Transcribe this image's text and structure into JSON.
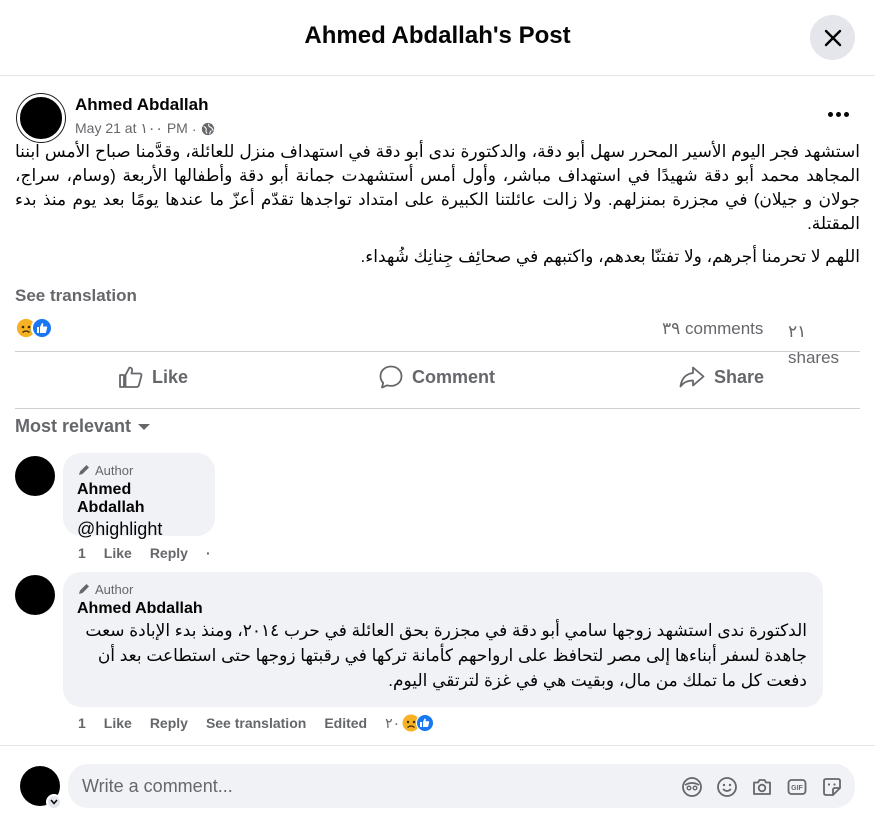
{
  "dialog": {
    "title": "Ahmed Abdallah's Post"
  },
  "post": {
    "author": "Ahmed Abdallah",
    "date": "May 21 at ١٠٠ PM",
    "separator": "·",
    "privacy_icon": "globe-icon",
    "paragraphs": [
      "استشهد فجر اليوم الأسير المحرر سهل أبو دقة، والدكتورة ندى أبو دقة في استهداف منزل للعائلة، وقدَّمنا صباح الأمس ابننا المجاهد محمد أبو دقة شهيدًا في استهداف مباشر، وأول أمس أستشهدت جمانة أبو دقة وأطفالها الأربعة (وسام، سراج، جولان و جيلان) في مجزرة بمنزلهم. ولا زالت عائلتنا الكبيرة على امتداد تواجدها تقدّم أعزّ ما عندها يومًا بعد يوم منذ بدء المقتلة.",
      "اللهم لا تحرمنا أجرهم، ولا تفتنّا بعدهم، واكتبهم في صحائِف جِنانِك شُهداء."
    ],
    "see_translation": "See translation",
    "reaction_icons": [
      "sad-face-icon",
      "like-icon"
    ],
    "comments_count": "٣٩ comments",
    "shares_count": "٢١ shares",
    "actions": {
      "like": "Like",
      "comment": "Comment",
      "share": "Share"
    }
  },
  "comments_filter": "Most relevant",
  "comments": [
    {
      "badge": "Author",
      "author": "Ahmed Abdallah",
      "text": "@highlight",
      "time": "1",
      "like": "Like",
      "reply": "Reply",
      "dot": "·"
    },
    {
      "badge": "Author",
      "author": "Ahmed Abdallah",
      "text": "الدكتورة ندى استشهد زوجها سامي أبو دقة في مجزرة بحق العائلة في حرب ٢٠١٤، ومنذ بدء الإبادة سعت جاهدة لسفر أبناءها إلى مصر لتحافظ على ارواحهم كأمانة تركها في رقبتها زوجها حتى استطاعت بعد أن دفعت كل ما تملك من مال، وبقيت هي في غزة لترتقي اليوم.",
      "time": "1",
      "like": "Like",
      "reply": "Reply",
      "see_translation": "See translation",
      "edited": "Edited",
      "reaction_count": "٢٠"
    }
  ],
  "composer": {
    "placeholder": "Write a comment...",
    "tools": [
      "avatar-sticker-icon",
      "emoji-icon",
      "camera-icon",
      "gif-icon",
      "sticker-icon"
    ]
  },
  "colors": {
    "primary_text": "#050505",
    "secondary_text": "#65676b",
    "bubble_bg": "#f0f2f5",
    "like_blue": "#1877f2",
    "sad_yellow": "#f7b125"
  }
}
